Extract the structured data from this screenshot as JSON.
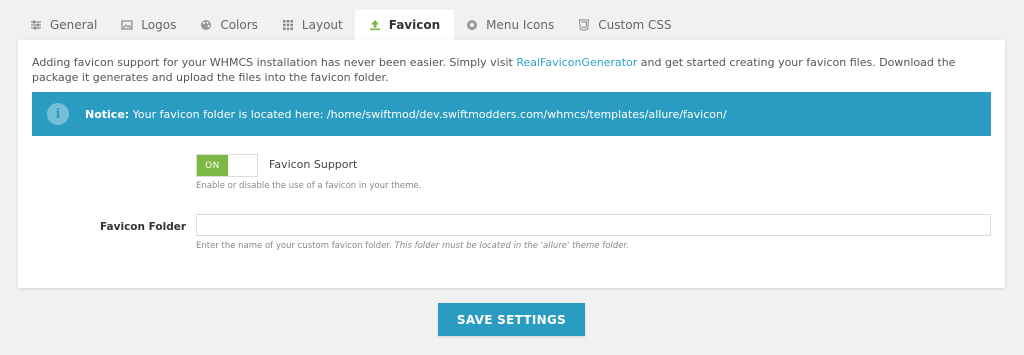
{
  "tabs": [
    {
      "label": "General",
      "icon": "sliders-icon",
      "active": false
    },
    {
      "label": "Logos",
      "icon": "image-icon",
      "active": false
    },
    {
      "label": "Colors",
      "icon": "palette-icon",
      "active": false
    },
    {
      "label": "Layout",
      "icon": "grid-icon",
      "active": false
    },
    {
      "label": "Favicon",
      "icon": "upload-icon",
      "active": true
    },
    {
      "label": "Menu Icons",
      "icon": "circle-icon",
      "active": false
    },
    {
      "label": "Custom CSS",
      "icon": "css3-icon",
      "active": false
    }
  ],
  "intro": {
    "text_before": "Adding favicon support for your WHMCS installation has never been easier. Simply visit ",
    "link_text": "RealFaviconGenerator",
    "text_after": " and get started creating your favicon files. Download the package it generates and upload the files into the favicon folder."
  },
  "notice": {
    "label": "Notice:",
    "text": " Your favicon folder is located here: /home/swiftmod/dev.swiftmodders.com/whmcs/templates/allure/favicon/"
  },
  "favicon_support": {
    "toggle_state": "ON",
    "label": "Favicon Support",
    "help": "Enable or disable the use of a favicon in your theme."
  },
  "favicon_folder": {
    "label": "Favicon Folder",
    "value": "",
    "placeholder": "",
    "help_normal": "Enter the name of your custom favicon folder. ",
    "help_italic": "This folder must be located in the 'allure' theme folder."
  },
  "save_button": "SAVE SETTINGS",
  "colors": {
    "accent": "#2b9cc1",
    "toggle_on": "#7cb944",
    "link": "#2ea2cc",
    "background": "#f1f1f1"
  }
}
